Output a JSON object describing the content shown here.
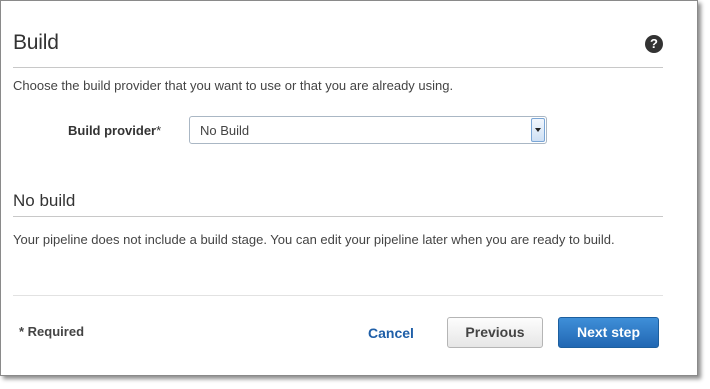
{
  "section": {
    "title": "Build",
    "help_icon": "?",
    "description": "Choose the build provider that you want to use or that you are already using."
  },
  "provider": {
    "label": "Build provider",
    "required_mark": "*",
    "selected": "No Build"
  },
  "no_build": {
    "heading": "No build",
    "text": "Your pipeline does not include a build stage. You can edit your pipeline later when you are ready to build."
  },
  "footer": {
    "required_note": "* Required",
    "cancel_label": "Cancel",
    "previous_label": "Previous",
    "next_label": "Next step"
  },
  "colors": {
    "link": "#1f5fa8",
    "primary_button": "#2a76c4"
  },
  "icons": {
    "help": "help-icon",
    "dropdown": "chevron-down-icon"
  }
}
